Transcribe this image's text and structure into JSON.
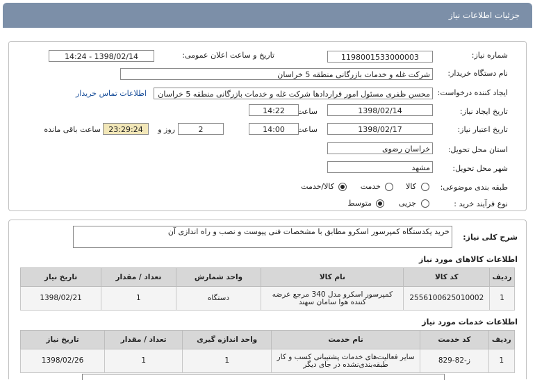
{
  "window": {
    "title": "جزئیات اطلاعات نیاز"
  },
  "form": {
    "need_number": {
      "label": "شماره نیاز:",
      "value": "1198001533000003"
    },
    "announce": {
      "label": "تاریخ و ساعت اعلان عمومی:",
      "value": "1398/02/14 - 14:24"
    },
    "buyer": {
      "label": "نام دستگاه خریدار:",
      "value": "شرکت غله و خدمات بازرگانی منطقه 5 خراسان"
    },
    "requester": {
      "label": "ایجاد کننده درخواست:",
      "value": "محسن ظفری مسئول امور قراردادها شرکت غله و خدمات بازرگانی منطقه 5 خراسان",
      "contact_link": "اطلاعات تماس خریدار"
    },
    "created": {
      "label": "تاریخ ایجاد نیاز:",
      "date": "1398/02/14",
      "time_label": "ساعت",
      "time": "14:22"
    },
    "validity": {
      "label": "تاریخ اعتبار نیاز:",
      "date": "1398/02/17",
      "time_label": "ساعت",
      "time": "14:00",
      "days": "2",
      "days_label": "روز و",
      "remaining": "23:29:24",
      "remaining_label": "ساعت باقی مانده"
    },
    "province": {
      "label": "استان محل تحویل:",
      "value": "خراسان رضوی"
    },
    "city": {
      "label": "شهر محل تحویل:",
      "value": "مشهد"
    },
    "category": {
      "label": "طبقه بندی موضوعی:",
      "options": [
        "کالا",
        "خدمت",
        "کالا/خدمت"
      ],
      "selected": "کالا/خدمت"
    },
    "process": {
      "label": "نوع فرآیند خرید :",
      "options": [
        "جزیی",
        "متوسط"
      ],
      "selected": "متوسط"
    }
  },
  "summary": {
    "label": "شرح کلی نیاز:",
    "value": "خرید یکدستگاه کمپرسور اسکرو مطابق با مشخصات فنی پیوست و نصب و راه اندازی آن"
  },
  "goods": {
    "title": "اطلاعات کالاهای مورد نیاز",
    "headers": [
      "ردیف",
      "کد کالا",
      "نام کالا",
      "واحد شمارش",
      "تعداد / مقدار",
      "تاریخ نیاز"
    ],
    "rows": [
      [
        "1",
        "2556100625010002",
        "کمپرسور اسکرو مدل 340 مرجع عرضه کننده هوا سامان سهند",
        "دستگاه",
        "1",
        "1398/02/21"
      ]
    ]
  },
  "services": {
    "title": "اطلاعات خدمات مورد نیاز",
    "headers": [
      "ردیف",
      "کد خدمت",
      "نام خدمت",
      "واحد اندازه گیری",
      "تعداد / مقدار",
      "تاریخ نیاز"
    ],
    "rows": [
      [
        "1",
        "ز-82-829",
        "سایر فعالیت‌های خدمات پشتیبانی کسب و کار طبقه‌بندی‌نشده در جای دیگر",
        "1",
        "1",
        "1398/02/26"
      ]
    ]
  }
}
